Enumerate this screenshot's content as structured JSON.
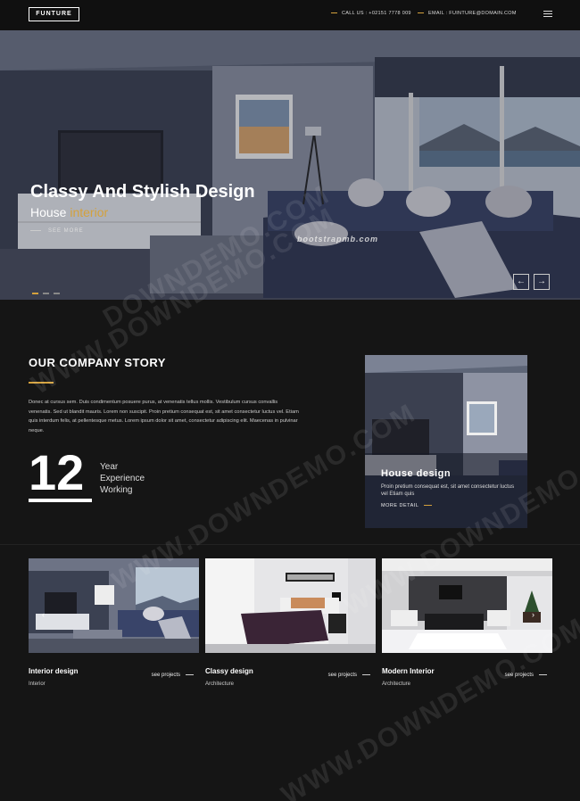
{
  "header": {
    "logo": "FUNTURE",
    "call": "CALL US : +02151 7778 009",
    "email": "EMAIL : FUINTURE@DOMAIN.COM"
  },
  "hero": {
    "title": "Classy And Stylish Design",
    "subtitle_main": "House ",
    "subtitle_accent": "interior",
    "see_more": "SEE MORE",
    "watermark": "bootstrapmb.com",
    "prev": "←",
    "next": "→"
  },
  "story": {
    "title": "OUR COMPANY STORY",
    "text": "Donec at cursus sem. Duis condimentum posuere purus, at venenatis tellus mollis. Vestibulum cursus convallis venenatis. Sed ut blandit mauris. Lorem non suscipit. Proin pretium consequat est, sit amet consectetur luctus vel. Etiam quis interdum felis, at pellentesque metus. Lorem ipsum dolor sit amet, consectetur adipiscing elit. Maecenas in pulvinar neque.",
    "number": "12",
    "years_line1": "Year",
    "years_line2": "Experience",
    "years_line3": "Working"
  },
  "card": {
    "title": "House design",
    "text": "Proin pretium consequat est, sit amet consectetur luctus vel Etiam quis",
    "more": "MORE DETAIL"
  },
  "projects": [
    {
      "name": "Interior design",
      "category": "Interior",
      "link": "see projects"
    },
    {
      "name": "Classy design",
      "category": "Architecture",
      "link": "see projects"
    },
    {
      "name": "Modern Interior",
      "category": "Architecture",
      "link": "see projects"
    }
  ],
  "watermarks": [
    "WWW.DOWNDEMO.COM",
    "WWW.DOWNDEMO.COM",
    "WWW.DOWNDEMO.COM",
    "WWW.DOWNDEMO.COM",
    "DOWNDEMO.COM"
  ],
  "colors": {
    "accent": "#d4a13c",
    "background": "#151515"
  }
}
